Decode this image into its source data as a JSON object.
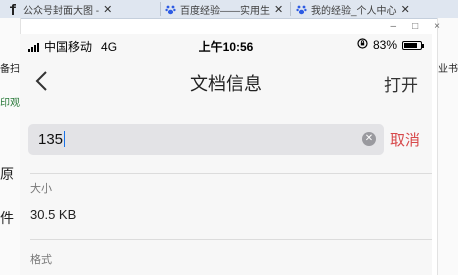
{
  "browser": {
    "tabs": [
      {
        "title": "公众号封面大图 - ",
        "icon": "f-logo-icon"
      },
      {
        "title": "百度经验——实用生",
        "icon": "baidu-paw-icon"
      },
      {
        "title": "我的经验_个人中心",
        "icon": "baidu-paw-icon"
      }
    ],
    "window_controls": {
      "minimize": "–",
      "maximize": "□",
      "close": "×"
    },
    "background_fragments": {
      "left": [
        "备扫",
        "印观",
        "原",
        "件"
      ],
      "right": [
        "业书"
      ]
    }
  },
  "status_bar": {
    "carrier": "中国移动",
    "network": "4G",
    "time": "上午10:56",
    "battery": "83%",
    "battery_level": 0.83
  },
  "navbar": {
    "title": "文档信息",
    "open_label": "打开"
  },
  "search": {
    "value": "135",
    "cancel_label": "取消"
  },
  "details": [
    {
      "label": "大小",
      "value": "30.5 KB"
    },
    {
      "label": "格式",
      "value": ""
    }
  ]
}
